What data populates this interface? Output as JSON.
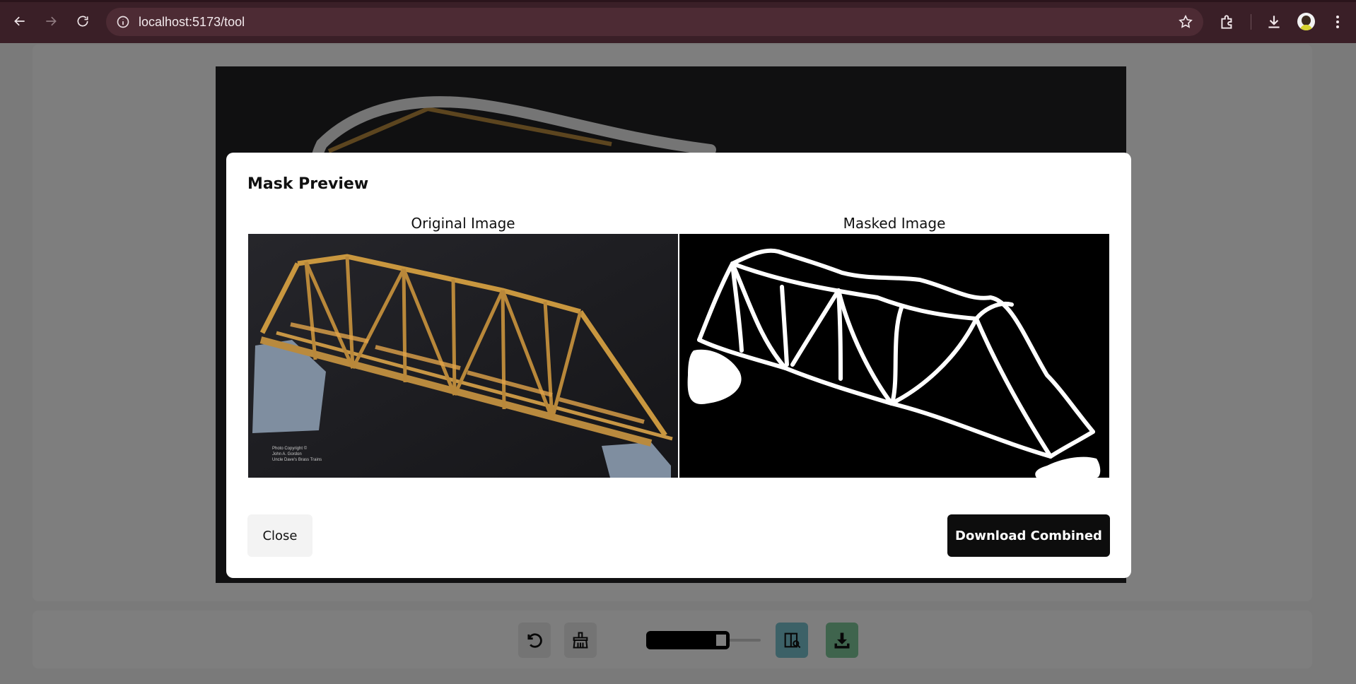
{
  "browser": {
    "url": "localhost:5173/tool",
    "icons": [
      "back-icon",
      "forward-icon",
      "reload-icon",
      "site-info-icon",
      "bookmark-star-icon",
      "extensions-icon",
      "downloads-icon",
      "profile-avatar",
      "menu-kebab-icon"
    ]
  },
  "toolbar": {
    "tools": [
      "undo-icon",
      "clear-brush-icon",
      "brush-size-slider",
      "preview-mask-icon",
      "download-icon"
    ],
    "brush_size_level": 0.73,
    "colors": {
      "preview_button": "#79c3cf",
      "download_button": "#7ec89a"
    }
  },
  "modal": {
    "title": "Mask Preview",
    "original_label": "Original Image",
    "masked_label": "Masked Image",
    "close_label": "Close",
    "download_label": "Download Combined",
    "photo_credit": [
      "Photo Copyright ©",
      "John A. Gordon",
      "Uncle Dave's Brass Trains"
    ]
  }
}
